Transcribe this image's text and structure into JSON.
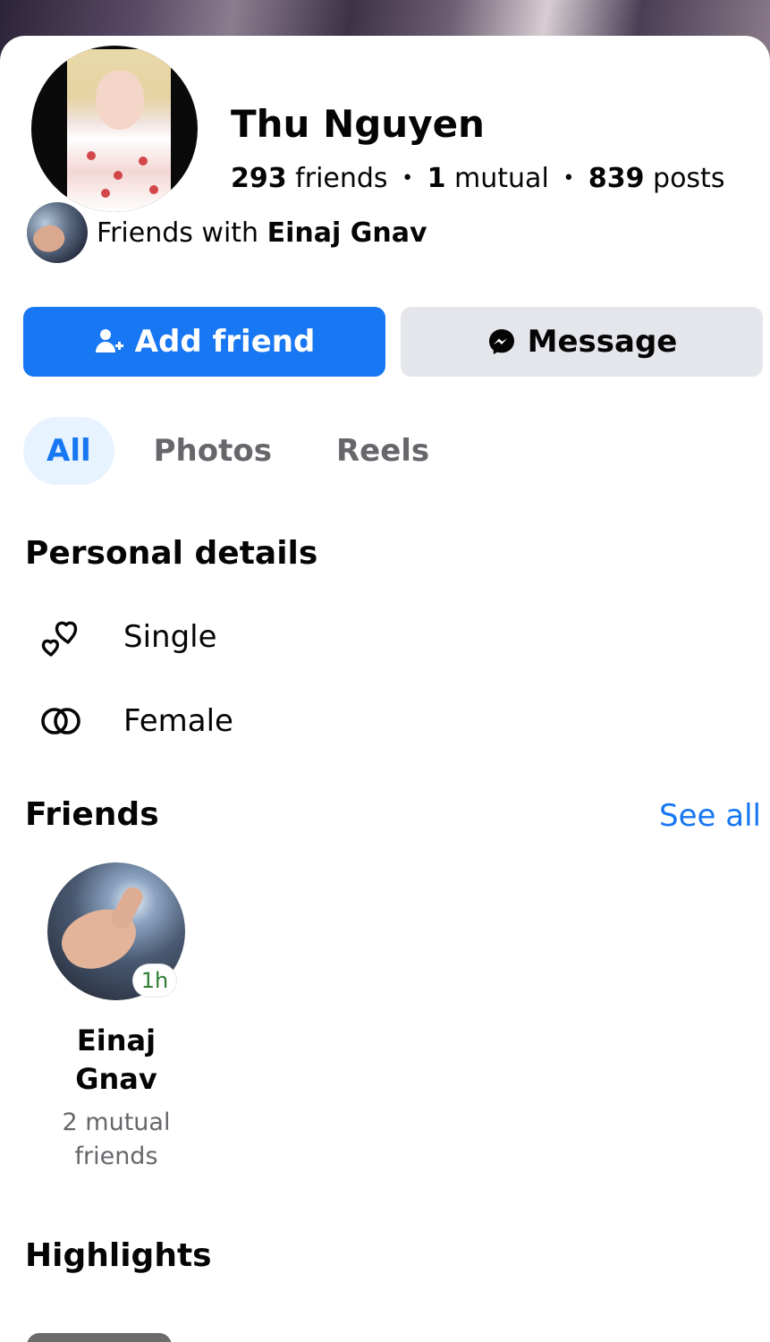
{
  "profile": {
    "name": "Thu Nguyen",
    "stats": {
      "friends_count": "293",
      "friends_label": "friends",
      "mutual_count": "1",
      "mutual_label": "mutual",
      "posts_count": "839",
      "posts_label": "posts",
      "separator": "•"
    },
    "friends_with": {
      "prefix": "Friends with",
      "name": "Einaj Gnav"
    }
  },
  "actions": {
    "add_friend_label": "Add friend",
    "message_label": "Message"
  },
  "tabs": [
    {
      "label": "All",
      "active": true
    },
    {
      "label": "Photos",
      "active": false
    },
    {
      "label": "Reels",
      "active": false
    }
  ],
  "personal_details": {
    "title": "Personal details",
    "items": [
      {
        "icon": "hearts-icon",
        "label": "Single"
      },
      {
        "icon": "gender-rings-icon",
        "label": "Female"
      }
    ]
  },
  "friends_section": {
    "title": "Friends",
    "see_all_label": "See all",
    "friends": [
      {
        "name_line1": "Einaj",
        "name_line2": "Gnav",
        "time_badge": "1h",
        "mutual_line1": "2 mutual",
        "mutual_line2": "friends"
      }
    ]
  },
  "highlights": {
    "title": "Highlights"
  },
  "colors": {
    "accent": "#1877f2",
    "secondary_button": "#e4e6eb",
    "active_tab_bg": "#e7f3ff",
    "muted_text": "#65676b",
    "time_badge_text": "#2e7d32"
  }
}
